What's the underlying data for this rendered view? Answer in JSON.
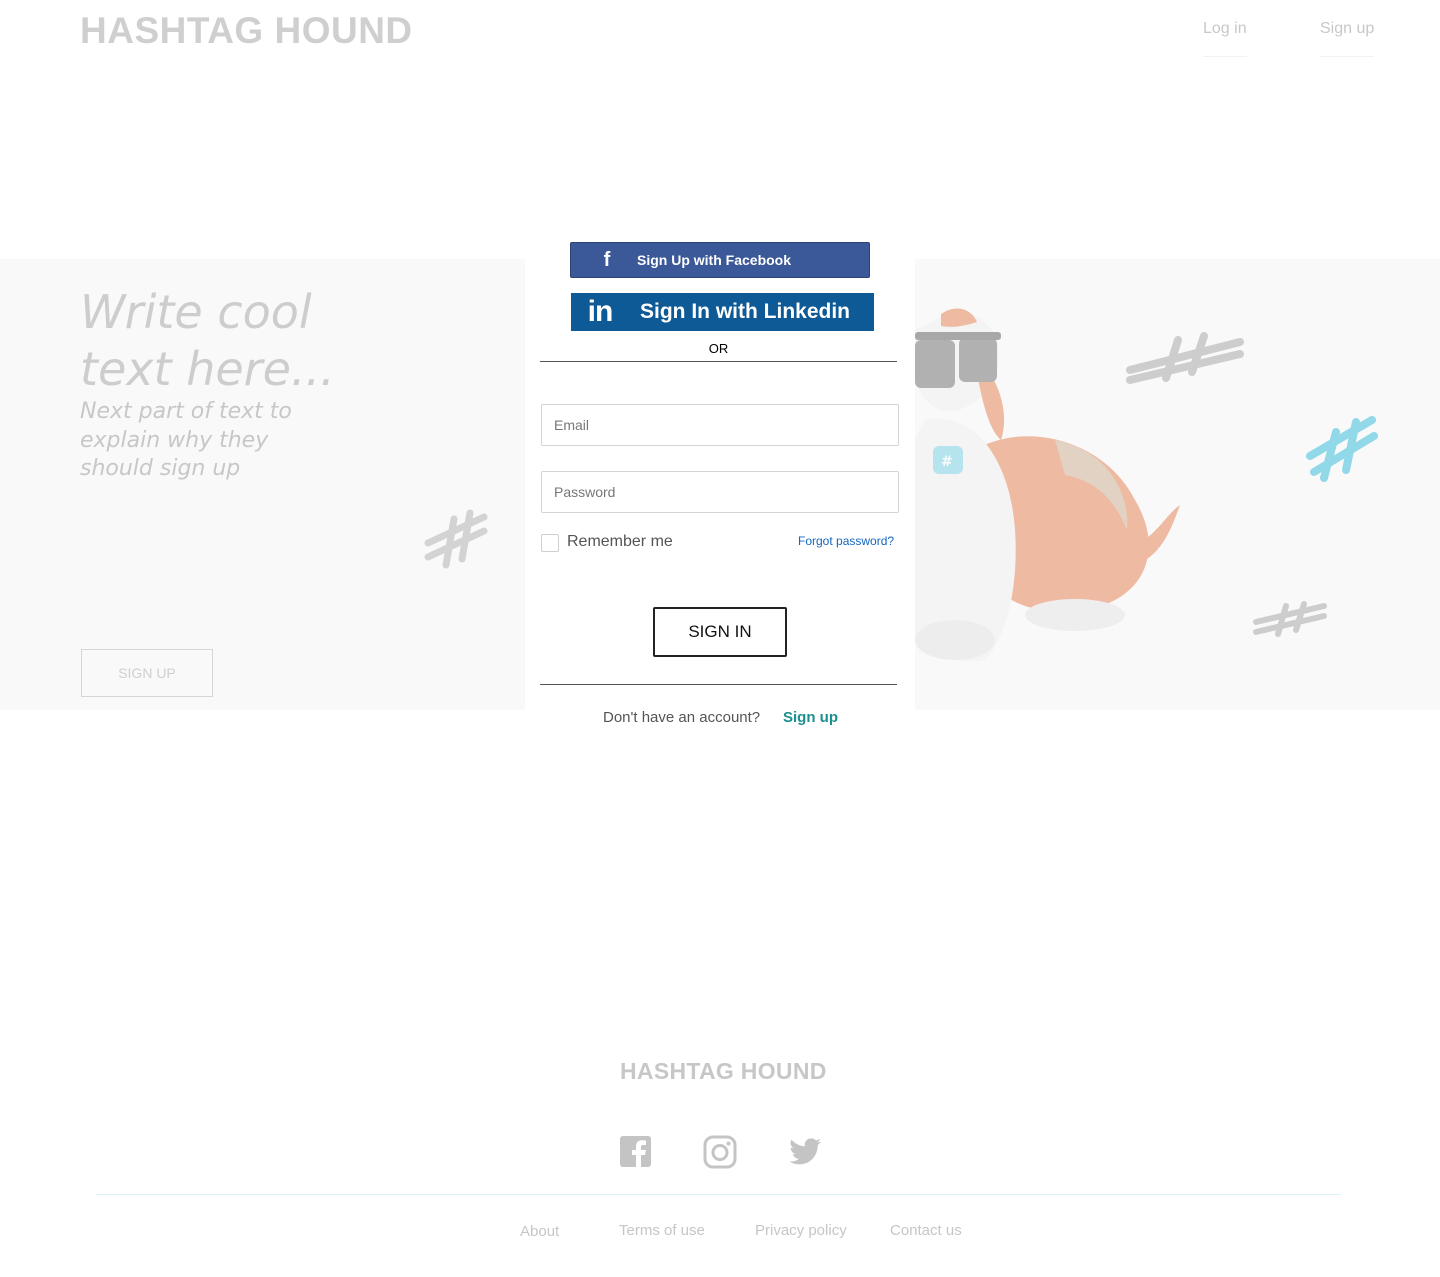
{
  "header": {
    "brand": "HASHTAG HOUND",
    "nav": {
      "login": "Log in",
      "signup": "Sign up"
    }
  },
  "hero": {
    "title_line1": "Write cool",
    "title_line2": "text here...",
    "sub_line1": "Next part of text to",
    "sub_line2": "explain why they",
    "sub_line3": "should sign up",
    "cta": "SIGN UP"
  },
  "modal": {
    "facebook_label": "Sign Up with Facebook",
    "facebook_icon": "f",
    "linkedin_label": "Sign In with Linkedin",
    "linkedin_icon": "in",
    "or": "OR",
    "email_placeholder": "Email",
    "email_value": "",
    "password_placeholder": "Password",
    "password_value": "",
    "remember_label": "Remember me",
    "remember_checked": false,
    "forgot": "Forgot password?",
    "signin": "SIGN IN",
    "no_account": "Don't have an account?",
    "signup_link": "Sign up"
  },
  "footer": {
    "brand": "HASHTAG HOUND",
    "social": [
      "facebook-icon",
      "instagram-icon",
      "twitter-icon"
    ],
    "links": [
      "About",
      "Terms of use",
      "Privacy policy",
      "Contact us"
    ]
  },
  "colors": {
    "facebook": "#3b5998",
    "linkedin": "#0e5a96",
    "signup_link": "#1b8f8f",
    "forgot_link": "#1565c0",
    "dog_accent": "#e07a4a",
    "hashtag_teal": "#7fd3e6"
  }
}
